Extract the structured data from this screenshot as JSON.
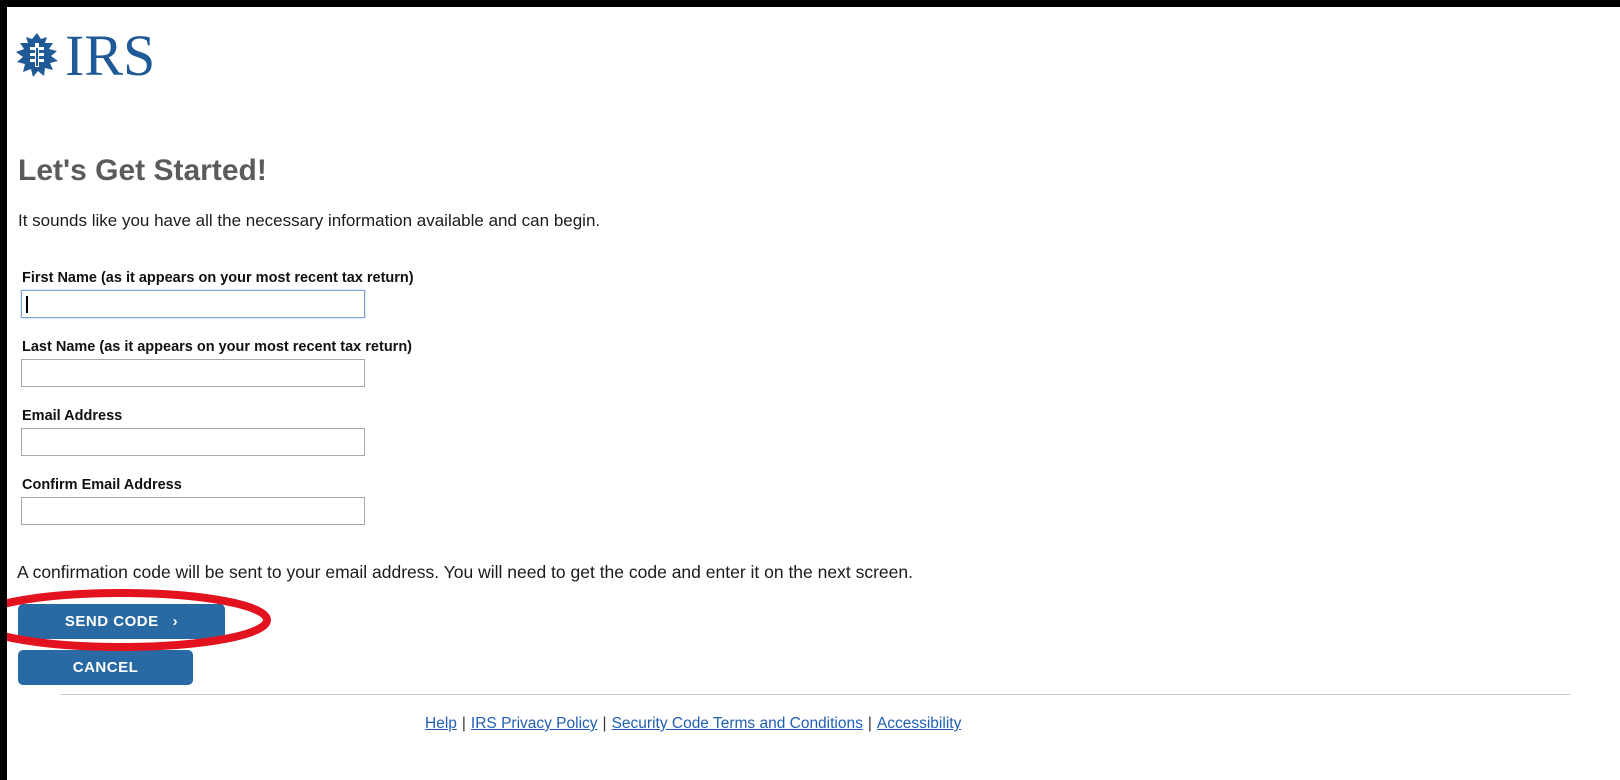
{
  "header": {
    "logo_text": "IRS",
    "logo_icon": "eagle-logo-icon"
  },
  "page": {
    "title": "Let's Get Started!",
    "intro": "It sounds like you have all the necessary information available and can begin."
  },
  "form": {
    "first_name_label": "First Name (as it appears on your most recent tax return)",
    "first_name_value": "",
    "last_name_label": "Last Name (as it appears on your most recent tax return)",
    "last_name_value": "",
    "email_label": "Email Address",
    "email_value": "",
    "confirm_email_label": "Confirm Email Address",
    "confirm_email_value": ""
  },
  "notice": "A confirmation code will be sent to your email address. You will need to get the code and enter it on the next screen.",
  "buttons": {
    "send_code": "SEND CODE",
    "send_code_icon": "chevron-right-icon",
    "cancel": "CANCEL"
  },
  "annotation": {
    "color": "#e3121f",
    "target": "send-code-button"
  },
  "footer": {
    "links": [
      "Help",
      "IRS Privacy Policy",
      "Security Code Terms and Conditions",
      "Accessibility"
    ],
    "separator": "|"
  },
  "colors": {
    "brand_blue": "#1f5a96",
    "button_blue": "#2a6aa4",
    "link_blue": "#1f5fb3",
    "title_gray": "#5b5b5b"
  }
}
